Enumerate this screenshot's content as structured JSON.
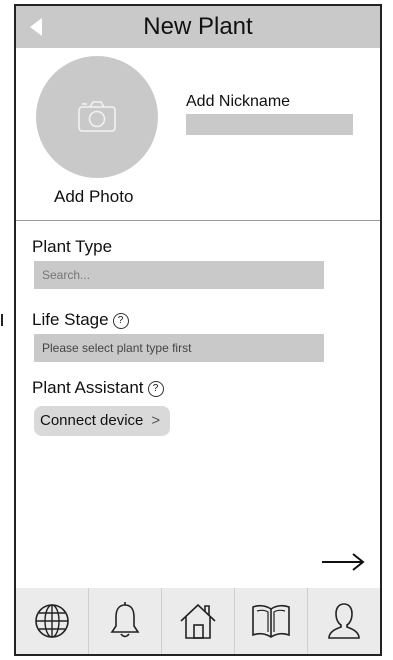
{
  "header": {
    "title": "New Plant"
  },
  "photo": {
    "label": "Add Photo"
  },
  "nickname": {
    "label": "Add Nickname",
    "value": ""
  },
  "plant_type": {
    "label": "Plant Type",
    "placeholder": "Search..."
  },
  "life_stage": {
    "label": "Life Stage",
    "help_glyph": "?",
    "placeholder": "Please select plant type first"
  },
  "assistant": {
    "label": "Plant Assistant",
    "help_glyph": "?",
    "button_label": "Connect device",
    "chevron": ">"
  },
  "tabs": [
    {
      "icon": "globe-icon"
    },
    {
      "icon": "bell-icon"
    },
    {
      "icon": "home-icon"
    },
    {
      "icon": "book-icon"
    },
    {
      "icon": "user-icon"
    }
  ],
  "colors": {
    "header_bg": "#c9c9c9",
    "field_bg": "#c9c9c9",
    "tabbar_bg": "#ebebeb"
  }
}
